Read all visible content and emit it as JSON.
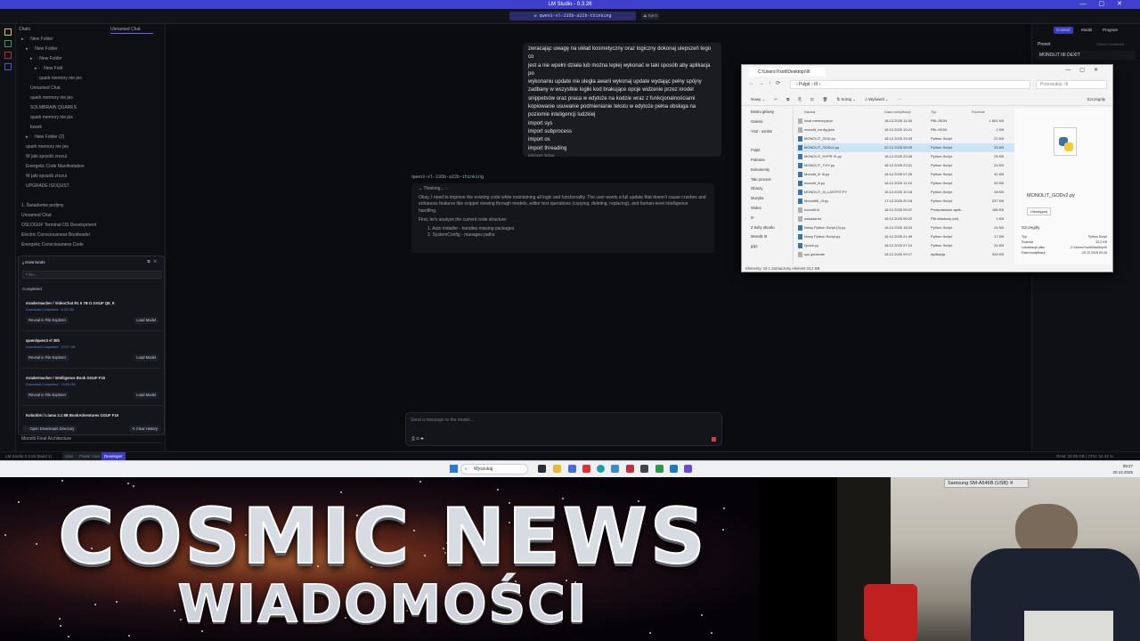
{
  "app": {
    "title": "LM Studio - 0.3.26",
    "model_selector": "⇄ qwen3-vl-235b-a22b-thinking",
    "eject": "⏏ Eject"
  },
  "sidebar": {
    "header": "Chats",
    "items": [
      {
        "label": "▸ 🗀 New Folder",
        "indent": 0
      },
      {
        "label": "▸ 🗀 New Folder",
        "indent": 1
      },
      {
        "label": "▸ 🗀 New Folder",
        "indent": 2
      },
      {
        "label": "▸ 🗀 New Fold",
        "indent": 3
      },
      {
        "label": "quark memory nie jes",
        "indent": 4
      },
      {
        "label": "Unnamed Chat",
        "indent": 2
      },
      {
        "label": "quark memory nie jes",
        "indent": 2
      },
      {
        "label": "SOLMBRAIN QUARKS",
        "indent": 2
      },
      {
        "label": "quark memory nie jes",
        "indent": 2
      },
      {
        "label": "kwark",
        "indent": 2
      },
      {
        "label": "▸ 🗀 New Folder (2)",
        "indent": 1
      },
      {
        "label": "quark memory nie jes",
        "indent": 1
      },
      {
        "label": "W jaki sposób zrozui",
        "indent": 1
      },
      {
        "label": "Energetic Code Manifestation",
        "indent": 1
      },
      {
        "label": "W jaki sposób zrozui",
        "indent": 1
      },
      {
        "label": "UPGRADE ISOQUST",
        "indent": 1
      },
      {
        "label": "",
        "indent": 0
      },
      {
        "label": "1. Świadomie podjmy",
        "indent": 0
      },
      {
        "label": "Unnamed Chat",
        "indent": 0
      },
      {
        "label": "OSLOGUF Terminal OS Development",
        "indent": 0
      },
      {
        "label": "Electric Consciousness Bootloader",
        "indent": 0
      },
      {
        "label": "Energetic Consciousness Code",
        "indent": 0
      }
    ],
    "bottom_item": "Monolit Final Architecture"
  },
  "chat": {
    "tab_title": "Unnamed Chat",
    "user_message": [
      "zwracając uwagę na układ kosmetyczny oraz logiczny dokonaj ulepszeń tego co",
      "jest a nie wpełni działa lub można lepiej wykonać w taki sposób aby aplikacja po",
      "wykonaniu update nie uległa awarii   wykonaj update wydając pełny spójny",
      "zadbany w wszystkie logiki kod brakujące opcje widzenie przez model",
      "snippetsów oraz praca w edytoże na kodzie wraz z funkcjonalnościami",
      "kopiowanie usuwanie podmienianie tekstu w edytoże pełna obsługa na",
      "poziomie inteligencji ludzkiej",
      "import sys",
      "import subprocess",
      "import os",
      "import threading",
      "import time",
      "import tkinter"
    ],
    "model_name": "qwen3-vl-235b-a22b-thinking",
    "thinking_label": "Thinking...",
    "thinking_text": "Okay, I need to improve the existing code while maintaining all logic and functionality. The user wants a full update that doesn't cause crashes and enhances features like snippet viewing through models, editor text operations (copying, deleting, replacing), and human-level intelligence handling.",
    "thinking_text2": "First, let's analyze the current code structure:",
    "thinking_list": [
      "1. Auto installer - handles missing packages",
      "2. SystemConfig - manages paths"
    ],
    "input_placeholder": "Send a message to the model..."
  },
  "right_panel": {
    "tabs": [
      "Context",
      "Model",
      "Program"
    ],
    "preset_label": "Preset",
    "preset_value": "MONOLIT IIII DEXIT",
    "cloned": "Cloned Unnamed"
  },
  "explorer": {
    "tab": "C:\\Users\\Ysolt\\Desktop\\\\III",
    "address": "› Pulpit › III ›",
    "search": "Przeszukaj: III",
    "toolbar": [
      "Nowy ⌄",
      "✂",
      "⧉",
      "⎘",
      "⊡",
      "🗑",
      "⇅ Sortuj ⌄",
      "≡ Wyświetl ⌄",
      "⋯"
    ],
    "details_button": "Szczegóły",
    "nav": [
      "Ekstra główny",
      "Galeria",
      "Ysol - osobis",
      "",
      "Pulpit",
      "Pobrane",
      "Dokumenty",
      "Taki procent",
      "Obrazy",
      "Muzyka",
      "Wideo",
      "III",
      "Z 5uity okrarło",
      "Monolit III",
      "gsjs"
    ],
    "headers": [
      "Nazwa",
      "Data modyfikacji",
      "Typ",
      "Rozmiar"
    ],
    "files": [
      {
        "name": "local memory.json",
        "date": "18.12.2025 11:38",
        "type": "Plik JSON",
        "size": "1 801 KB"
      },
      {
        "name": "monolit_config.json",
        "date": "16.12.2025 10:21",
        "type": "Plik JSON",
        "size": "1 KB"
      },
      {
        "name": "MONOLIT_GOD.py",
        "date": "18.12.2025 23:33",
        "type": "Python Script",
        "size": "22 KB"
      },
      {
        "name": "MONOLIT_GODv2.py",
        "date": "20.12.2025 09:25",
        "type": "Python Script",
        "size": "33 KB"
      },
      {
        "name": "MONOLIT_HYPR IX.py",
        "date": "18.12.2025 23:28",
        "type": "Python Script",
        "size": "25 KB"
      },
      {
        "name": "MONOLIT_T.HY.py",
        "date": "18.12.2025 23:21",
        "type": "Python Script",
        "size": "24 KB"
      },
      {
        "name": "Monolit_III III.py",
        "date": "16.12.2025 07:26",
        "type": "Python Script",
        "size": "41 KB"
      },
      {
        "name": "monolit_iii.py",
        "date": "16.12.2025 11:19",
        "type": "Python Script",
        "size": "39 KB"
      },
      {
        "name": "MONOLIT_III_LASTFIT.PY",
        "date": "16.12.2025 10:18",
        "type": "Python Script",
        "size": "28 KB"
      },
      {
        "name": "MonolitIII_III.py",
        "date": "17.12.2025 20:18",
        "type": "Python Script",
        "size": "237 KB"
      },
      {
        "name": "monolit.iii",
        "date": "16.12.2025 09:37",
        "type": "Przeprawione aplik...",
        "size": "186 KB"
      },
      {
        "name": "nazwaa.txt",
        "date": "16.12.2025 09:22",
        "type": "Plik tekstowy (txt)",
        "size": "1 KB"
      },
      {
        "name": "Nowy Python Script (3).py",
        "date": "16.12.2025 18:24",
        "type": "Python Script",
        "size": "24 KB"
      },
      {
        "name": "Nowy Python Script.py",
        "date": "16.12.2025 21:49",
        "type": "Python Script",
        "size": "17 KB"
      },
      {
        "name": "Quark.py",
        "date": "16.12.2025 07:14",
        "type": "Python Script",
        "size": "24 KB"
      },
      {
        "name": "sys generate",
        "date": "18.12.2025 09:17",
        "type": "Aplikacja",
        "size": "326 KB"
      }
    ],
    "preview_file": "MONOLIT_GODv2.py",
    "preview_button": "Udostępnij",
    "props_title": "Szczegóły",
    "props": [
      [
        "Typ",
        "Python Script"
      ],
      [
        "Rozmiar",
        "33,2 KB"
      ],
      [
        "Lokalizacja pliku",
        "C:\\Users\\Ysolt\\Desktop\\III"
      ],
      [
        "Data modyfikacji",
        "20.12.2025 09:25"
      ]
    ],
    "status": "Elementy: 16   1 zaznaczony element  33,2 KB"
  },
  "downloads": {
    "title": "Downloads",
    "filter_placeholder": "Filter...",
    "section": "Completed",
    "items": [
      {
        "title": "mradermacher / VideoChat R1 5 7B I1 GGUF Q6_K",
        "status": "Download Completed · 6.25 GB"
      },
      {
        "title": "qwen/qwen3 vl 30b",
        "status": "Download Completed · 23.97 GB"
      },
      {
        "title": "mradermacher / Intelligence Book GGUF F16",
        "status": "Download Completed · 15.09 GB"
      },
      {
        "title": "KoboldAI / Llama 3.1 8B BookAdventures GGUF F16",
        "status": ""
      }
    ],
    "reveal_label": "Reveal in File Explorer",
    "load_label": "Load Model",
    "open_dir": "Open Downloads Directory",
    "clear": "Clear History"
  },
  "statusbar": {
    "left": "LM Studio 0.3.26 (Build 1)",
    "modes": [
      "User",
      "Power User",
      "Developer"
    ],
    "right": "RAM: 33.05 GB | CPU: 34.42 %"
  },
  "taskbar": {
    "search": "Wyszukaj",
    "time": "09:27",
    "date": "20.12.2025"
  },
  "banner": {
    "line1": "COSMIC NEWS",
    "line2": "WIADOMOŚCI"
  },
  "webcam": {
    "label": "Samsung SM-A546B (USB)"
  },
  "colors": {
    "accent": "#4040d0",
    "select": "#cce4f7",
    "python_yellow": "#f6c936",
    "python_blue": "#3b73a8"
  }
}
